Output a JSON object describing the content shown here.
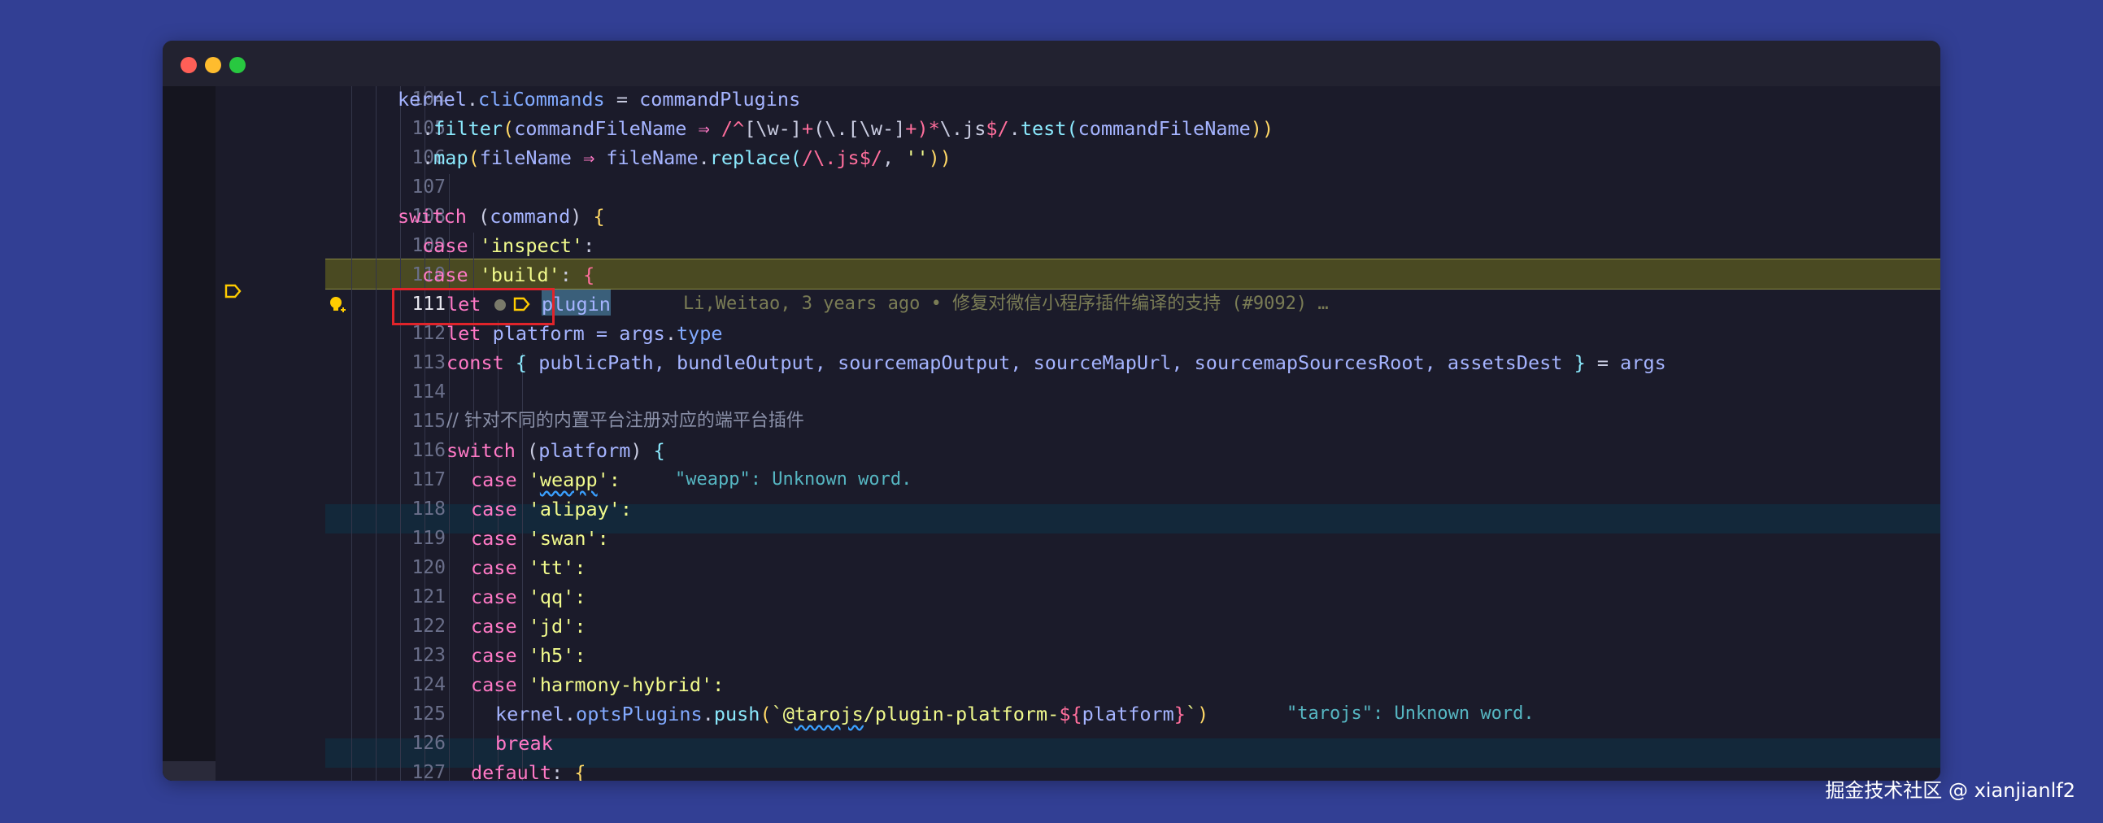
{
  "window": {
    "controls": {
      "close_color": "#ff5f57",
      "minimize_color": "#febc2e",
      "zoom_color": "#28c840"
    }
  },
  "lines": [
    {
      "n": "104"
    },
    {
      "n": "105"
    },
    {
      "n": "106"
    },
    {
      "n": "107"
    },
    {
      "n": "108"
    },
    {
      "n": "109"
    },
    {
      "n": "110"
    },
    {
      "n": "111"
    },
    {
      "n": "112"
    },
    {
      "n": "113"
    },
    {
      "n": "114"
    },
    {
      "n": "115"
    },
    {
      "n": "116"
    },
    {
      "n": "117"
    },
    {
      "n": "118"
    },
    {
      "n": "119"
    },
    {
      "n": "120"
    },
    {
      "n": "121"
    },
    {
      "n": "122"
    },
    {
      "n": "123"
    },
    {
      "n": "124"
    },
    {
      "n": "125"
    },
    {
      "n": "126"
    },
    {
      "n": "127"
    }
  ],
  "code": {
    "l104": {
      "a": "kernel",
      "b": ".",
      "c": "cliCommands",
      "d": " = ",
      "e": "commandPlugins"
    },
    "l105": {
      "a": ".",
      "b": "filter",
      "c": "(",
      "d": "commandFileName",
      "e": " ⇒ ",
      "f": "/^",
      "g": "[\\w-]",
      "h": "+",
      "i": "(\\.",
      "j": "[\\w-]",
      "k": "+",
      "l": ")*",
      "m": "\\.js",
      "n": "$",
      "o": "/",
      "p": ".",
      "q": "test",
      "r": "(",
      "s": "commandFileName",
      "t": "))"
    },
    "l106": {
      "a": ".",
      "b": "map",
      "c": "(",
      "d": "fileName",
      "e": " ⇒ ",
      "f": "fileName",
      "g": ".",
      "h": "replace",
      "i": "(",
      "j": "/\\.js$/",
      "k": ", ",
      "l": "''",
      "m": "))"
    },
    "l108": {
      "a": "switch",
      "b": " (",
      "c": "command",
      "d": ") ",
      "e": "{"
    },
    "l109": {
      "a": "case",
      "b": " ",
      "c": "'inspect'",
      "d": ":"
    },
    "l110": {
      "a": "case",
      "b": " ",
      "c": "'build'",
      "d": ": ",
      "e": "{"
    },
    "l111": {
      "a": "let",
      "b": "plugin",
      "blame": "Li,Weitao, 3 years ago • 修复对微信小程序插件编译的支持 (#9092) …"
    },
    "l112": {
      "a": "let",
      "b": " platform = ",
      "c": "args",
      "d": ".",
      "e": "type"
    },
    "l113": {
      "a": "const",
      "b": " ",
      "c": "{",
      "d": " publicPath, bundleOutput, sourcemapOutput, sourceMapUrl, sourcemapSourcesRoot, assetsDest ",
      "e": "}",
      "f": " = ",
      "g": "args"
    },
    "l115": {
      "a": "// 针对不同的内置平台注册对应的端平台插件"
    },
    "l116": {
      "a": "switch",
      "b": " (",
      "c": "platform",
      "d": ") ",
      "e": "{"
    },
    "l117": {
      "a": "case",
      "b": " '",
      "c": "weapp",
      "d": "':",
      "diag": "\"weapp\": Unknown word."
    },
    "l118": {
      "a": "case",
      "b": " 'alipay':"
    },
    "l119": {
      "a": "case",
      "b": " 'swan':"
    },
    "l120": {
      "a": "case",
      "b": " 'tt':"
    },
    "l121": {
      "a": "case",
      "b": " 'qq':"
    },
    "l122": {
      "a": "case",
      "b": " 'jd':"
    },
    "l123": {
      "a": "case",
      "b": " 'h5':"
    },
    "l124": {
      "a": "case",
      "b": " 'harmony-hybrid':"
    },
    "l125": {
      "a": "kernel",
      "b": ".",
      "c": "optsPlugins",
      "d": ".",
      "e": "push",
      "f": "(",
      "g": "`@",
      "h": "tarojs",
      "i": "/plugin-platform-",
      "j": "${",
      "k": "platform",
      "l": "}",
      "m": "`",
      "n": ")",
      "diag": "\"tarojs\": Unknown word."
    },
    "l126": {
      "a": "break"
    },
    "l127": {
      "a": "default",
      "b": ": ",
      "c": "{"
    }
  },
  "watermark": "掘金技术社区 @ xianjianlf2",
  "colors": {
    "background": "#323f94",
    "editor_bg": "#1b1b2a",
    "highlight_line": "#4a4a22",
    "diagnostic_line": "#13283a",
    "annotation_box": "#e0242a"
  }
}
